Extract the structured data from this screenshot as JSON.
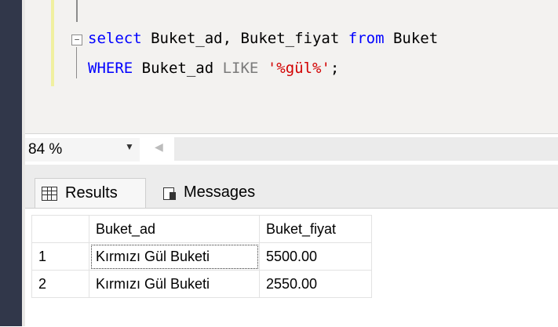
{
  "editor": {
    "line1": {
      "select": "select",
      "cols": " Buket_ad, Buket_fiyat ",
      "from": "from",
      "table": " Buket"
    },
    "line2": {
      "where": "WHERE",
      "col": " Buket_ad ",
      "like": "LIKE",
      "space": " ",
      "pattern": "'%gül%'",
      "semi": ";"
    },
    "collapse_glyph": "−"
  },
  "zoom": {
    "value": "84 %",
    "dropdown_arrow": "▼",
    "scroll_left": "◀"
  },
  "tabs": {
    "results": "Results",
    "messages": "Messages",
    "results_icon": "grid-icon",
    "messages_icon": "messages-icon"
  },
  "results": {
    "headers": [
      "Buket_ad",
      "Buket_fiyat"
    ],
    "rows": [
      {
        "num": "1",
        "ad": "Kırmızı Gül Buketi",
        "fiyat": "5500.00"
      },
      {
        "num": "2",
        "ad": "Kırmızı Gül Buketi",
        "fiyat": "2550.00"
      }
    ]
  },
  "colors": {
    "keyword": "#0000ff",
    "string": "#d20000",
    "gray_keyword": "#7a7a7a",
    "left_rail": "#31374a"
  }
}
